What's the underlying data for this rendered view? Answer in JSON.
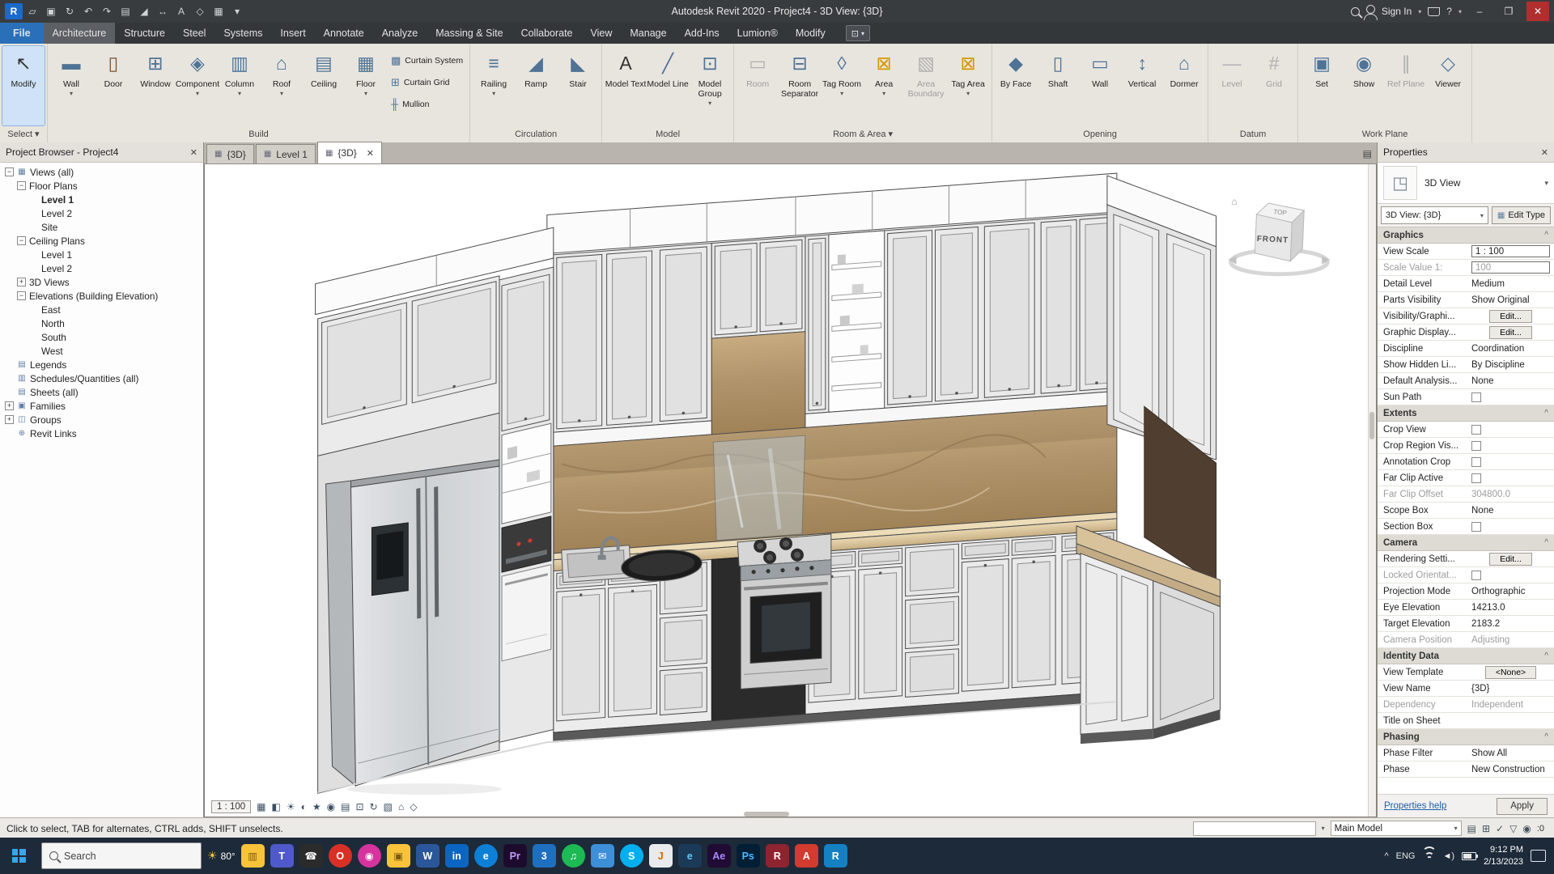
{
  "title_bar": {
    "title": "Autodesk Revit 2020 - Project4 - 3D View: {3D}",
    "sign_in": "Sign In",
    "quick_icons": [
      {
        "name": "revit-logo-icon",
        "glyph": "R",
        "logo": true
      },
      {
        "name": "open-icon",
        "glyph": "▱"
      },
      {
        "name": "save-icon",
        "glyph": "▣"
      },
      {
        "name": "sync-icon",
        "glyph": "↻"
      },
      {
        "name": "undo-icon",
        "glyph": "↶"
      },
      {
        "name": "redo-icon",
        "glyph": "↷"
      },
      {
        "name": "print-icon",
        "glyph": "▤"
      },
      {
        "name": "measure-icon",
        "glyph": "◢"
      },
      {
        "name": "aligned-dimension-icon",
        "glyph": "↔"
      },
      {
        "name": "text-icon",
        "glyph": "A"
      },
      {
        "name": "3d-view-icon",
        "glyph": "◇"
      },
      {
        "name": "section-icon",
        "glyph": "▦"
      },
      {
        "name": "customize-qat-icon",
        "glyph": "▾"
      }
    ]
  },
  "ribbon": {
    "file_tab": "File",
    "tabs": [
      "Architecture",
      "Structure",
      "Steel",
      "Systems",
      "Insert",
      "Annotate",
      "Analyze",
      "Massing & Site",
      "Collaborate",
      "View",
      "Manage",
      "Add-Ins",
      "Lumion®",
      "Modify"
    ],
    "active_tab": "Architecture",
    "panels": [
      {
        "name": "Select",
        "caret": true,
        "buttons": [
          {
            "label": "Modify",
            "icon": "cursor",
            "selected": true
          }
        ]
      },
      {
        "name": "Build",
        "buttons": [
          {
            "label": "Wall",
            "icon": "wall",
            "caret": true
          },
          {
            "label": "Door",
            "icon": "door"
          },
          {
            "label": "Window",
            "icon": "window"
          },
          {
            "label": "Component",
            "icon": "component",
            "caret": true
          },
          {
            "label": "Column",
            "icon": "column",
            "caret": true
          },
          {
            "label": "Roof",
            "icon": "roof",
            "caret": true
          },
          {
            "label": "Ceiling",
            "icon": "ceiling"
          },
          {
            "label": "Floor",
            "icon": "floor",
            "caret": true
          }
        ],
        "stack": [
          {
            "label": "Curtain System",
            "icon": "csys"
          },
          {
            "label": "Curtain Grid",
            "icon": "cgrid"
          },
          {
            "label": "Mullion",
            "icon": "mullion"
          }
        ]
      },
      {
        "name": "Circulation",
        "buttons": [
          {
            "label": "Railing",
            "icon": "railing",
            "caret": true
          },
          {
            "label": "Ramp",
            "icon": "ramp"
          },
          {
            "label": "Stair",
            "icon": "stair"
          }
        ]
      },
      {
        "name": "Model",
        "buttons": [
          {
            "label": "Model Text",
            "icon": "mtext"
          },
          {
            "label": "Model Line",
            "icon": "mline"
          },
          {
            "label": "Model Group",
            "icon": "mgroup",
            "caret": true
          }
        ]
      },
      {
        "name": "Room & Area",
        "caret": true,
        "buttons": [
          {
            "label": "Room",
            "icon": "room",
            "disabled": true
          },
          {
            "label": "Room Separator",
            "icon": "rsep"
          },
          {
            "label": "Tag Room",
            "icon": "tagroom",
            "caret": true
          },
          {
            "label": "Area",
            "icon": "area",
            "caret": true
          },
          {
            "label": "Area Boundary",
            "icon": "abound",
            "disabled": true
          },
          {
            "label": "Tag Area",
            "icon": "tagarea",
            "caret": true
          }
        ]
      },
      {
        "name": "Opening",
        "buttons": [
          {
            "label": "By Face",
            "icon": "byface"
          },
          {
            "label": "Shaft",
            "icon": "shaft"
          },
          {
            "label": "Wall",
            "icon": "owall"
          },
          {
            "label": "Vertical",
            "icon": "vert"
          },
          {
            "label": "Dormer",
            "icon": "dormer"
          }
        ]
      },
      {
        "name": "Datum",
        "buttons": [
          {
            "label": "Level",
            "icon": "level",
            "disabled": true
          },
          {
            "label": "Grid",
            "icon": "grid",
            "disabled": true
          }
        ]
      },
      {
        "name": "Work Plane",
        "buttons": [
          {
            "label": "Set",
            "icon": "set"
          },
          {
            "label": "Show",
            "icon": "show"
          },
          {
            "label": "Ref Plane",
            "icon": "refplane",
            "disabled": true
          },
          {
            "label": "Viewer",
            "icon": "viewer"
          }
        ]
      }
    ]
  },
  "browser": {
    "header": "Project Browser - Project4",
    "tree": [
      {
        "label": "Views (all)",
        "indent": 0,
        "exp": "-",
        "icon": "▦"
      },
      {
        "label": "Floor Plans",
        "indent": 1,
        "exp": "-"
      },
      {
        "label": "Level 1",
        "indent": 2,
        "selected": true
      },
      {
        "label": "Level 2",
        "indent": 2
      },
      {
        "label": "Site",
        "indent": 2
      },
      {
        "label": "Ceiling Plans",
        "indent": 1,
        "exp": "-"
      },
      {
        "label": "Level 1",
        "indent": 2
      },
      {
        "label": "Level 2",
        "indent": 2
      },
      {
        "label": "3D Views",
        "indent": 1,
        "exp": "+"
      },
      {
        "label": "Elevations (Building Elevation)",
        "indent": 1,
        "exp": "-"
      },
      {
        "label": "East",
        "indent": 2
      },
      {
        "label": "North",
        "indent": 2
      },
      {
        "label": "South",
        "indent": 2
      },
      {
        "label": "West",
        "indent": 2
      },
      {
        "label": "Legends",
        "indent": 0,
        "icon": "▤"
      },
      {
        "label": "Schedules/Quantities (all)",
        "indent": 0,
        "icon": "▥"
      },
      {
        "label": "Sheets (all)",
        "indent": 0,
        "icon": "▤"
      },
      {
        "label": "Families",
        "indent": 0,
        "exp": "+",
        "icon": "▣"
      },
      {
        "label": "Groups",
        "indent": 0,
        "exp": "+",
        "icon": "◫"
      },
      {
        "label": "Revit Links",
        "indent": 0,
        "icon": "⊕"
      }
    ]
  },
  "doc_tabs": [
    {
      "label": "{3D}"
    },
    {
      "label": "Level 1"
    },
    {
      "label": "{3D}",
      "active": true
    }
  ],
  "viewcube": {
    "front": "FRONT",
    "top": "TOP"
  },
  "view_bar": {
    "scale": "1 : 100",
    "icons": [
      "▦",
      "◧",
      "☀",
      "◐",
      "★",
      "◉",
      "▤",
      "⊡",
      "↻",
      "▧",
      "⌂",
      "◇"
    ]
  },
  "properties": {
    "header": "Properties",
    "close": "✕",
    "type_label": "3D View",
    "selector": "3D View: {3D}",
    "edit_type": "Edit Type",
    "sections": [
      {
        "name": "Graphics",
        "rows": [
          {
            "label": "View Scale",
            "value": "1 : 100",
            "kind": "box"
          },
          {
            "label": "Scale Value 1:",
            "value": "100",
            "kind": "box",
            "muted": true
          },
          {
            "label": "Detail Level",
            "value": "Medium"
          },
          {
            "label": "Parts Visibility",
            "value": "Show Original"
          },
          {
            "label": "Visibility/Graphi...",
            "value": "Edit...",
            "kind": "button"
          },
          {
            "label": "Graphic Display...",
            "value": "Edit...",
            "kind": "button"
          },
          {
            "label": "Discipline",
            "value": "Coordination"
          },
          {
            "label": "Show Hidden Li...",
            "value": "By Discipline"
          },
          {
            "label": "Default Analysis...",
            "value": "None"
          },
          {
            "label": "Sun Path",
            "kind": "checkbox"
          }
        ]
      },
      {
        "name": "Extents",
        "rows": [
          {
            "label": "Crop View",
            "kind": "checkbox"
          },
          {
            "label": "Crop Region Vis...",
            "kind": "checkbox"
          },
          {
            "label": "Annotation Crop",
            "kind": "checkbox"
          },
          {
            "label": "Far Clip Active",
            "kind": "checkbox"
          },
          {
            "label": "Far Clip Offset",
            "value": "304800.0",
            "muted": true
          },
          {
            "label": "Scope Box",
            "value": "None"
          },
          {
            "label": "Section Box",
            "kind": "checkbox"
          }
        ]
      },
      {
        "name": "Camera",
        "rows": [
          {
            "label": "Rendering Setti...",
            "value": "Edit...",
            "kind": "button"
          },
          {
            "label": "Locked Orientat...",
            "kind": "checkbox",
            "muted": true
          },
          {
            "label": "Projection Mode",
            "value": "Orthographic"
          },
          {
            "label": "Eye Elevation",
            "value": "14213.0"
          },
          {
            "label": "Target Elevation",
            "value": "2183.2"
          },
          {
            "label": "Camera Position",
            "value": "Adjusting",
            "muted": true
          }
        ]
      },
      {
        "name": "Identity Data",
        "rows": [
          {
            "label": "View Template",
            "value": "<None>",
            "kind": "button"
          },
          {
            "label": "View Name",
            "value": "{3D}"
          },
          {
            "label": "Dependency",
            "value": "Independent",
            "muted": true
          },
          {
            "label": "Title on Sheet",
            "value": ""
          }
        ]
      },
      {
        "name": "Phasing",
        "rows": [
          {
            "label": "Phase Filter",
            "value": "Show All"
          },
          {
            "label": "Phase",
            "value": "New Construction"
          }
        ]
      }
    ],
    "help_link": "Properties help",
    "apply": "Apply"
  },
  "status_bar": {
    "hint": "Click to select, TAB for alternates, CTRL adds, SHIFT unselects.",
    "main_model": "Main Model",
    "selection_count": "0",
    "right_icons": [
      "▤",
      "⊞",
      "✓",
      "▽",
      "◉"
    ]
  },
  "taskbar": {
    "search_placeholder": "Search",
    "weather": "80°",
    "apps": [
      {
        "name": "file-explorer",
        "glyph": "▥",
        "bg": "#f8c33a",
        "fg": "#7a5b10"
      },
      {
        "name": "teams",
        "glyph": "T",
        "bg": "#5059c9",
        "fg": "#ffffff"
      },
      {
        "name": "phone",
        "glyph": "☎",
        "bg": "#2b2b2b",
        "fg": "#ffffff"
      },
      {
        "name": "opera",
        "glyph": "O",
        "bg": "#d93025",
        "fg": "#ffffff",
        "round": true
      },
      {
        "name": "instagram",
        "glyph": "◉",
        "bg": "#d6339f",
        "fg": "#ffffff",
        "round": true
      },
      {
        "name": "folder",
        "glyph": "▣",
        "bg": "#f8c33a",
        "fg": "#7a5b10"
      },
      {
        "name": "word",
        "glyph": "W",
        "bg": "#2b579a",
        "fg": "#ffffff"
      },
      {
        "name": "linkedin",
        "glyph": "in",
        "bg": "#0a66c2",
        "fg": "#ffffff"
      },
      {
        "name": "edge",
        "glyph": "e",
        "bg": "#0d7fd6",
        "fg": "#ffffff",
        "round": true
      },
      {
        "name": "premiere",
        "glyph": "Pr",
        "bg": "#1d0b2e",
        "fg": "#c79bff"
      },
      {
        "name": "word-viewer",
        "glyph": "3",
        "bg": "#1f6fc0",
        "fg": "#ffffff"
      },
      {
        "name": "spotify",
        "glyph": "♫",
        "bg": "#1db954",
        "fg": "#ffffff",
        "round": true
      },
      {
        "name": "mail",
        "glyph": "✉",
        "bg": "#3d8fd8",
        "fg": "#ffffff"
      },
      {
        "name": "skype",
        "glyph": "S",
        "bg": "#00aff0",
        "fg": "#ffffff",
        "round": true
      },
      {
        "name": "java",
        "glyph": "J",
        "bg": "#e8eaed",
        "fg": "#d66a00"
      },
      {
        "name": "internet-explorer",
        "glyph": "e",
        "bg": "#1b3a57",
        "fg": "#64c7f0"
      },
      {
        "name": "after-effects",
        "glyph": "Ae",
        "bg": "#1f0b33",
        "fg": "#a78bfa"
      },
      {
        "name": "photoshop",
        "glyph": "Ps",
        "bg": "#001e36",
        "fg": "#4db8ff"
      },
      {
        "name": "r-app",
        "glyph": "R",
        "bg": "#8e2430",
        "fg": "#ffffff"
      },
      {
        "name": "autodesk",
        "glyph": "A",
        "bg": "#d23b2e",
        "fg": "#ffffff"
      },
      {
        "name": "revit-app",
        "glyph": "R",
        "bg": "#1481c3",
        "fg": "#ffffff"
      }
    ],
    "tray": {
      "lang": "ENG",
      "time": "9:12 PM",
      "date": "2/13/2023"
    }
  }
}
